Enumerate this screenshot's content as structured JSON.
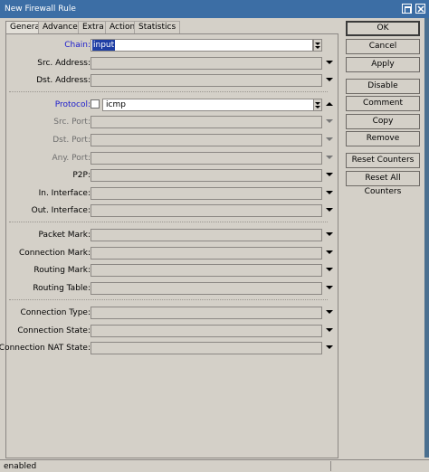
{
  "window": {
    "title": "New Firewall Rule"
  },
  "tabs": [
    "General",
    "Advanced",
    "Extra",
    "Action",
    "Statistics"
  ],
  "fields": {
    "chain": {
      "label": "Chain:",
      "value": "input"
    },
    "src_address": {
      "label": "Src. Address:",
      "value": ""
    },
    "dst_address": {
      "label": "Dst. Address:",
      "value": ""
    },
    "protocol": {
      "label": "Protocol:",
      "value": "icmp"
    },
    "src_port": {
      "label": "Src. Port:",
      "value": ""
    },
    "dst_port": {
      "label": "Dst. Port:",
      "value": ""
    },
    "any_port": {
      "label": "Any. Port:",
      "value": ""
    },
    "p2p": {
      "label": "P2P:",
      "value": ""
    },
    "in_interface": {
      "label": "In. Interface:",
      "value": ""
    },
    "out_interface": {
      "label": "Out. Interface:",
      "value": ""
    },
    "packet_mark": {
      "label": "Packet Mark:",
      "value": ""
    },
    "connection_mark": {
      "label": "Connection Mark:",
      "value": ""
    },
    "routing_mark": {
      "label": "Routing Mark:",
      "value": ""
    },
    "routing_table": {
      "label": "Routing Table:",
      "value": ""
    },
    "connection_type": {
      "label": "Connection Type:",
      "value": ""
    },
    "connection_state": {
      "label": "Connection State:",
      "value": ""
    },
    "connection_nat_state": {
      "label": "Connection NAT State:",
      "value": ""
    }
  },
  "buttons": {
    "ok": "OK",
    "cancel": "Cancel",
    "apply": "Apply",
    "disable": "Disable",
    "comment": "Comment",
    "copy": "Copy",
    "remove": "Remove",
    "reset_counters": "Reset Counters",
    "reset_all_counters": "Reset All Counters"
  },
  "status": {
    "text": "enabled"
  },
  "colors": {
    "titlebar": "#3c6ea5",
    "link_label": "#1a1acc",
    "selection": "#1f3fa5"
  },
  "icons": [
    "restore-icon",
    "close-icon",
    "dropdown-arrow-icon",
    "collapse-arrow-icon",
    "spin-toggle-icon"
  ]
}
